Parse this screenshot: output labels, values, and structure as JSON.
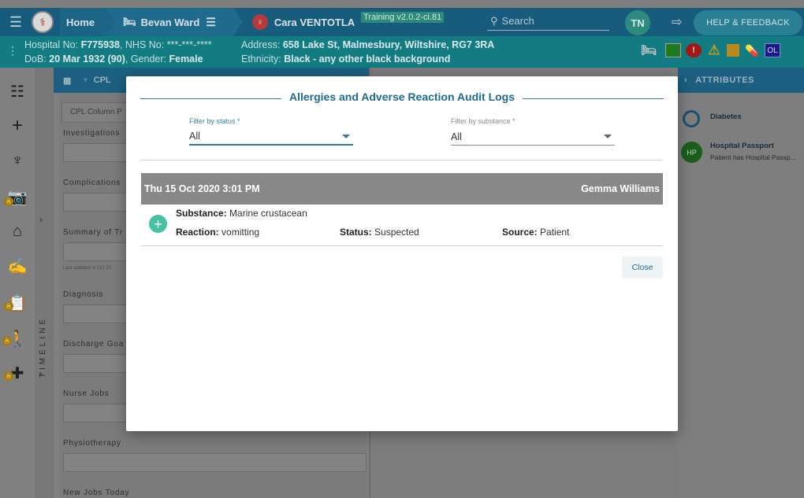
{
  "topbar": {
    "home_label": "Home",
    "ward_label": "Bevan Ward",
    "patient_name": "Cara VENTOTLA",
    "version_badge": "Training v2.0.2-ci.81",
    "search_placeholder": "Search",
    "user_initials": "TN",
    "help_label": "HELP & FEEDBACK"
  },
  "banner": {
    "hospital_no_label": "Hospital No:",
    "hospital_no": "F775938",
    "nhs_label": ", NHS No:",
    "nhs_no": "***-***-****",
    "dob_label": "DoB:",
    "dob": "20 Mar 1932 (90)",
    "gender_label": ", Gender:",
    "gender": "Female",
    "address_label": "Address:",
    "address": "658 Lake St, Malmesbury, Wiltshire, RG7 3RA",
    "ethnicity_label": "Ethnicity:",
    "ethnicity": "Black - any other black background",
    "ol_badge": "OL"
  },
  "timeline": {
    "label": "TIMELINE"
  },
  "cpl": {
    "header": "CPL",
    "column_placeholder": "CPL Column P",
    "sections": [
      "Investigations",
      "Complications",
      "Summary of Tr",
      "Diagnosis",
      "Discharge Goa",
      "Nurse Jobs",
      "Physiotherapy",
      "New Jobs Today"
    ],
    "last_updated": "Last updated: 6 Oct 20"
  },
  "attributes": {
    "header": "ATTRIBUTES",
    "diabetes": "Diabetes",
    "hp_initials": "HP",
    "hp_title": "Hospital Passport",
    "hp_subtitle": "Patient has Hospital Passp..."
  },
  "modal": {
    "title": "Allergies and Adverse Reaction Audit Logs",
    "filter_status_label": "Filter by status *",
    "filter_status_value": "All",
    "filter_substance_label": "Filter by substance *",
    "filter_substance_value": "All",
    "log": {
      "datetime": "Thu 15 Oct 2020 3:01 PM",
      "user": "Gemma Williams",
      "substance_label": "Substance:",
      "substance": "Marine crustacean",
      "reaction_label": "Reaction:",
      "reaction": "vomitting",
      "status_label": "Status:",
      "status": "Suspected",
      "source_label": "Source:",
      "source": "Patient"
    },
    "close_label": "Close"
  },
  "colors": {
    "topbar": "#175b7d",
    "banner": "#137c83",
    "accent": "#1e6a96",
    "plus_green": "#45c2a3"
  }
}
